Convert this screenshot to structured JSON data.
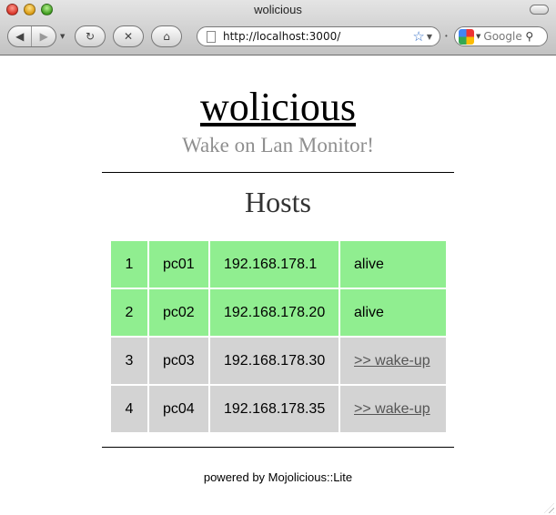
{
  "window": {
    "title": "wolicious"
  },
  "toolbar": {
    "back_icon": "back-arrow-icon",
    "forward_icon": "forward-arrow-icon",
    "reload_icon": "reload-icon",
    "stop_icon": "stop-icon",
    "home_icon": "home-icon",
    "url": "http://localhost:3000/",
    "search_placeholder": "Google"
  },
  "page": {
    "title": "wolicious",
    "subtitle": "Wake on Lan Monitor!",
    "section_title": "Hosts",
    "footer": "powered by Mojolicious::Lite"
  },
  "hosts": [
    {
      "num": "1",
      "name": "pc01",
      "ip": "192.168.178.1",
      "status": "alive",
      "state": "alive"
    },
    {
      "num": "2",
      "name": "pc02",
      "ip": "192.168.178.20",
      "status": "alive",
      "state": "alive"
    },
    {
      "num": "3",
      "name": "pc03",
      "ip": "192.168.178.30",
      "status": ">> wake-up",
      "state": "down"
    },
    {
      "num": "4",
      "name": "pc04",
      "ip": "192.168.178.35",
      "status": ">> wake-up",
      "state": "down"
    }
  ],
  "colors": {
    "alive_row": "#90ee90",
    "down_row": "#d3d3d3",
    "subtitle": "#8f8f8f"
  }
}
